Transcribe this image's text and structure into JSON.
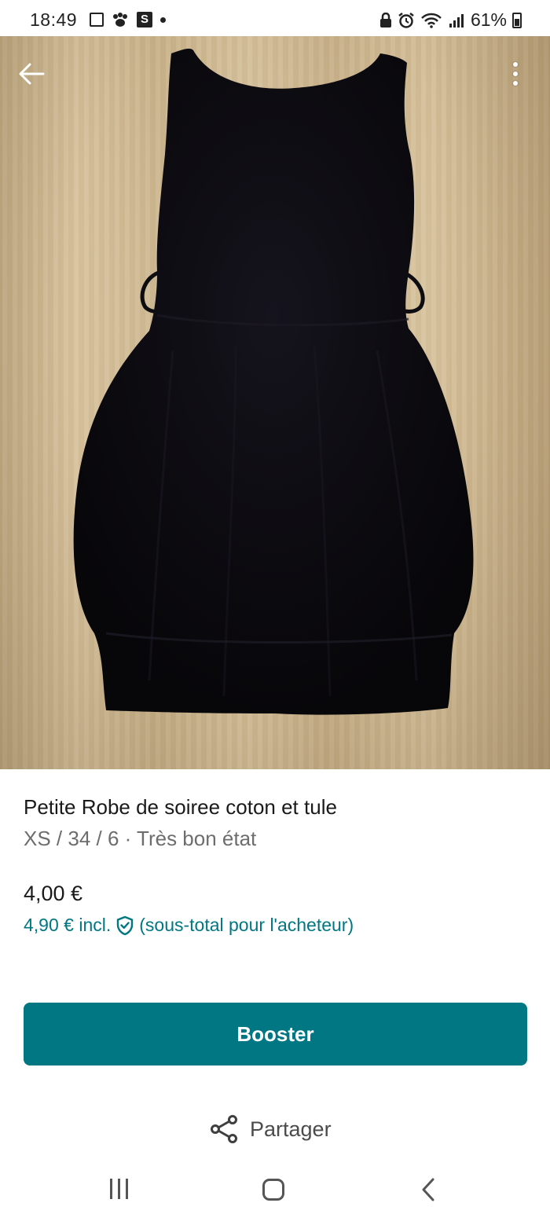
{
  "status_bar": {
    "time": "18:49",
    "battery": "61%"
  },
  "listing": {
    "title": "Petite Robe de soiree coton et tule",
    "subtitle": "XS / 34 / 6 · Très bon état",
    "price": "4,00 €",
    "price_incl": "4,90 € incl.",
    "price_incl_note": "(sous-total pour l'acheteur)"
  },
  "actions": {
    "booster_label": "Booster",
    "share_label": "Partager"
  },
  "colors": {
    "accent": "#007782"
  },
  "icons": [
    "back-arrow-icon",
    "more-vertical-icon",
    "shield-check-icon",
    "share-icon",
    "recents-icon",
    "home-icon",
    "nav-back-icon"
  ]
}
